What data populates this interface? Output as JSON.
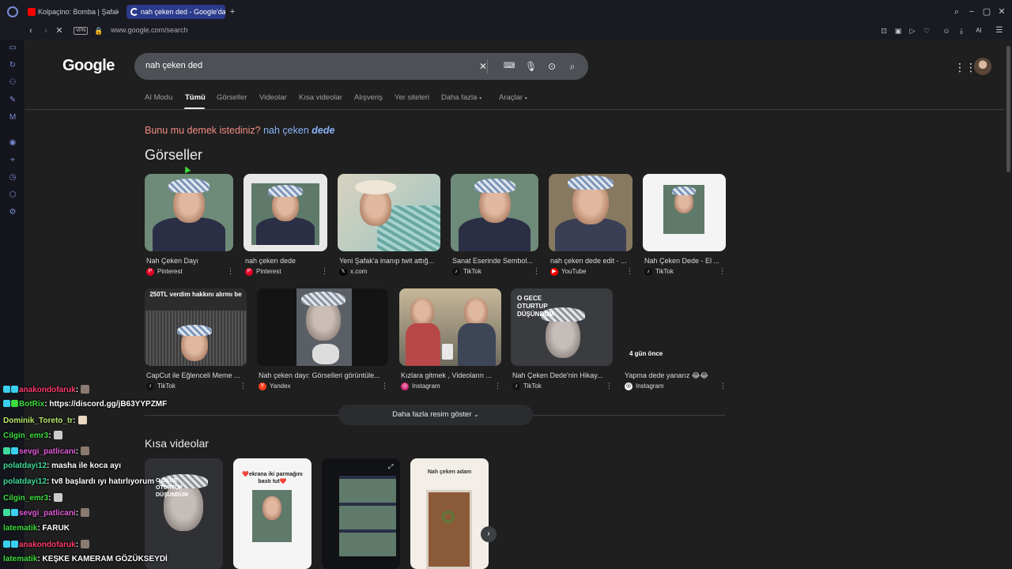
{
  "browser": {
    "tabs": [
      {
        "title": "Kolpaçino: Bomba | Şafak",
        "active": false
      },
      {
        "title": "nah çeken ded - Google'da",
        "active": true
      }
    ],
    "url": "www.google.com/search",
    "vpn_label": "VPN",
    "ai_label": "AI"
  },
  "google": {
    "logo": "Google",
    "query": "nah çeken ded",
    "nav_tabs": [
      "AI Modu",
      "Tümü",
      "Görseller",
      "Videolar",
      "Kısa videolar",
      "Alışveriş",
      "Yer siteleri",
      "Daha fazla",
      "Araçlar"
    ],
    "active_tab": "Tümü",
    "did_you_mean": {
      "prefix": "Bunu mu demek istediniz?",
      "suggestion_plain": "nah çeken",
      "suggestion_bold": "dede"
    },
    "images_heading": "Görseller",
    "images_row1": [
      {
        "caption": "Nah Çeken Dayı",
        "source": "Pinterest",
        "source_color": "#e60023"
      },
      {
        "caption": "nah çeken dede",
        "source": "Pinterest",
        "source_color": "#e60023"
      },
      {
        "caption": "Yeni Şafak'a inanıp twit attığ...",
        "source": "x.com",
        "source_color": "#000000"
      },
      {
        "caption": "Sanat Eserinde Sembol...",
        "source": "TikTok",
        "source_color": "#111111"
      },
      {
        "caption": "nah çeken dede edit - ...",
        "source": "YouTube",
        "source_color": "#ff0000"
      },
      {
        "caption": "Nah Çeken Dede - El ...",
        "source": "TikTok",
        "source_color": "#111111"
      }
    ],
    "images_row2": [
      {
        "caption": "CapCut ile Eğlenceli Meme ...",
        "source": "TikTok",
        "source_color": "#111111",
        "overlay": "250TL verdim hakkını alırmı be"
      },
      {
        "caption": "Nah çeken dayı: Görselleri görüntüle...",
        "source": "Yandex",
        "source_color": "#fc3f1d",
        "overlay": ""
      },
      {
        "caption": "Kızlara gitmek , Videoların ...",
        "source": "Instagram",
        "source_color": "#d62976",
        "overlay": ""
      },
      {
        "caption": "Nah Çeken Dede'nin Hikay...",
        "source": "TikTok",
        "source_color": "#111111",
        "overlay": "O GECE OTURTUP DÜŞÜNDÜM"
      },
      {
        "caption": "Yapma dede yanarız 😂😂",
        "source": "Instagram",
        "source_color": "#ffffff",
        "overlay": "4 gün önce"
      }
    ],
    "more_images": "Daha fazla resim göster",
    "shorts_heading": "Kısa videolar",
    "shorts_overlays": [
      "O GECE OTURTUP DÜŞÜNDÜM",
      "❤️ekrana iki parmağını bastı tut❤️",
      "",
      "Nah çeken adam"
    ]
  },
  "chat": [
    {
      "user": "anakondofaruk",
      "color": "#ff3b6b",
      "message": ""
    },
    {
      "user": "BotRix",
      "color": "#3ddc3d",
      "message": "https://discord.gg/jB63YYPZMF"
    },
    {
      "user": "Dominik_Toreto_tr",
      "color": "#b8e86b",
      "message": ""
    },
    {
      "user": "Cilgin_emr3",
      "color": "#3ddc3d",
      "message": ""
    },
    {
      "user": "sevgi_patlicani",
      "color": "#e25bd8",
      "message": ""
    },
    {
      "user": "polatdayi12",
      "color": "#3ddc9b",
      "message": "masha ile koca ayı"
    },
    {
      "user": "polatdayi12",
      "color": "#3ddc9b",
      "message": "tv8 başlardı ıyı hatırlıyorum"
    },
    {
      "user": "Cilgin_emr3",
      "color": "#3ddc3d",
      "message": ""
    },
    {
      "user": "sevgi_patlicani",
      "color": "#e25bd8",
      "message": ""
    },
    {
      "user": "latematik",
      "color": "#3ddc3d",
      "message": "FARUK"
    },
    {
      "user": "anakondofaruk",
      "color": "#ff3b6b",
      "message": ""
    },
    {
      "user": "latematik",
      "color": "#3ddc3d",
      "message": "KEŞKE KAMERAM GÖZÜKSEYDİ"
    }
  ],
  "icons": [
    "opera-logo",
    "back-icon",
    "forward-icon",
    "stop-icon",
    "lock-icon",
    "clear-icon",
    "keyboard-icon",
    "mic-icon",
    "lens-icon",
    "search-icon",
    "apps-icon",
    "kebab-icon"
  ]
}
